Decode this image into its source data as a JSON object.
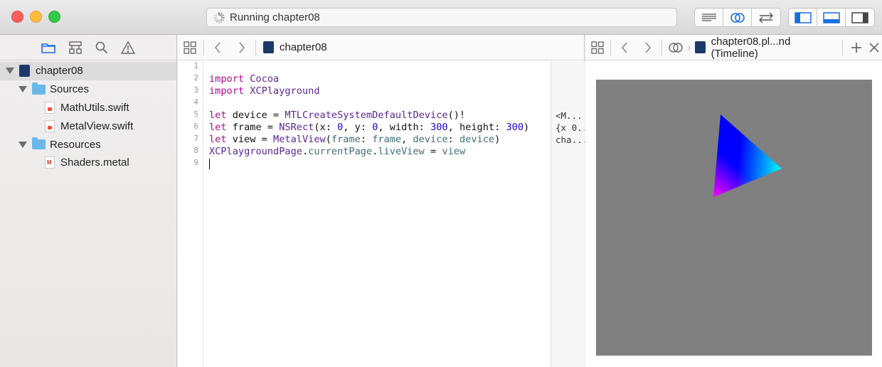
{
  "window": {
    "status_text": "Running chapter08"
  },
  "toolbar": {
    "buttons": [
      "standard-editor-icon",
      "assistant-editor-icon",
      "version-editor-icon",
      "navigator-toggle-icon",
      "debug-area-toggle-icon",
      "utilities-toggle-icon"
    ]
  },
  "navigator": {
    "tabs": [
      "project-navigator-icon",
      "symbol-navigator-icon",
      "find-navigator-icon",
      "issue-navigator-icon"
    ],
    "project": "chapter08",
    "sources_folder": "Sources",
    "files_sources": [
      "MathUtils.swift",
      "MetalView.swift"
    ],
    "resources_folder": "Resources",
    "files_resources": [
      "Shaders.metal"
    ]
  },
  "editor": {
    "jump_title": "chapter08",
    "line_numbers": [
      "1",
      "2",
      "3",
      "4",
      "5",
      "6",
      "7",
      "8",
      "9"
    ],
    "code_lines": [
      "",
      "import Cocoa",
      "import XCPlayground",
      "",
      "let device = MTLCreateSystemDefaultDevice()!",
      "let frame = NSRect(x: 0, y: 0, width: 300, height: 300)",
      "let view = MetalView(frame: frame, device: device)",
      "XCPlaygroundPage.currentPage.liveView = view",
      ""
    ],
    "results": [
      "<M...",
      "{x 0...",
      "cha..."
    ]
  },
  "assistant": {
    "jump_title": "chapter08.pl...nd (Timeline)"
  },
  "colors": {
    "live_view_bg": "#808080",
    "triangle_top": "#0000ff",
    "triangle_right": "#00ff00",
    "triangle_left": "#ff0000"
  }
}
